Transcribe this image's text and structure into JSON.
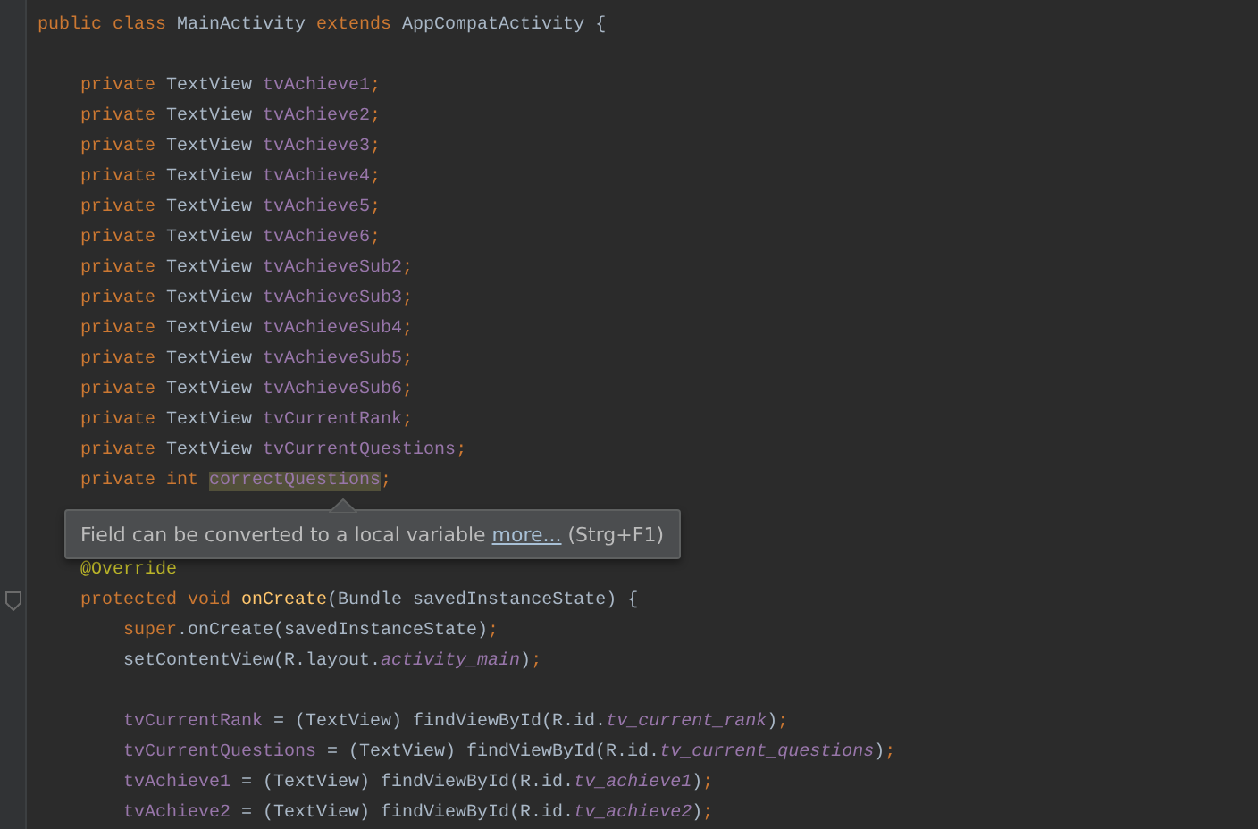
{
  "editor": {
    "lines": [
      {
        "kind": "code",
        "tokens": [
          {
            "text": "public class ",
            "kind": "keyword"
          },
          {
            "text": "MainActivity ",
            "kind": "plain"
          },
          {
            "text": "extends ",
            "kind": "keyword"
          },
          {
            "text": "AppCompatActivity {",
            "kind": "plain"
          }
        ]
      },
      {
        "kind": "blank"
      },
      {
        "kind": "code",
        "tokens": [
          {
            "text": "    private ",
            "kind": "keyword"
          },
          {
            "text": "TextView ",
            "kind": "plain"
          },
          {
            "text": "tvAchieve1",
            "kind": "field"
          },
          {
            "text": ";",
            "kind": "keyword"
          }
        ]
      },
      {
        "kind": "code",
        "tokens": [
          {
            "text": "    private ",
            "kind": "keyword"
          },
          {
            "text": "TextView ",
            "kind": "plain"
          },
          {
            "text": "tvAchieve2",
            "kind": "field"
          },
          {
            "text": ";",
            "kind": "keyword"
          }
        ]
      },
      {
        "kind": "code",
        "tokens": [
          {
            "text": "    private ",
            "kind": "keyword"
          },
          {
            "text": "TextView ",
            "kind": "plain"
          },
          {
            "text": "tvAchieve3",
            "kind": "field"
          },
          {
            "text": ";",
            "kind": "keyword"
          }
        ]
      },
      {
        "kind": "code",
        "tokens": [
          {
            "text": "    private ",
            "kind": "keyword"
          },
          {
            "text": "TextView ",
            "kind": "plain"
          },
          {
            "text": "tvAchieve4",
            "kind": "field"
          },
          {
            "text": ";",
            "kind": "keyword"
          }
        ]
      },
      {
        "kind": "code",
        "tokens": [
          {
            "text": "    private ",
            "kind": "keyword"
          },
          {
            "text": "TextView ",
            "kind": "plain"
          },
          {
            "text": "tvAchieve5",
            "kind": "field"
          },
          {
            "text": ";",
            "kind": "keyword"
          }
        ]
      },
      {
        "kind": "code",
        "tokens": [
          {
            "text": "    private ",
            "kind": "keyword"
          },
          {
            "text": "TextView ",
            "kind": "plain"
          },
          {
            "text": "tvAchieve6",
            "kind": "field"
          },
          {
            "text": ";",
            "kind": "keyword"
          }
        ]
      },
      {
        "kind": "code",
        "tokens": [
          {
            "text": "    private ",
            "kind": "keyword"
          },
          {
            "text": "TextView ",
            "kind": "plain"
          },
          {
            "text": "tvAchieveSub2",
            "kind": "field"
          },
          {
            "text": ";",
            "kind": "keyword"
          }
        ]
      },
      {
        "kind": "code",
        "tokens": [
          {
            "text": "    private ",
            "kind": "keyword"
          },
          {
            "text": "TextView ",
            "kind": "plain"
          },
          {
            "text": "tvAchieveSub3",
            "kind": "field"
          },
          {
            "text": ";",
            "kind": "keyword"
          }
        ]
      },
      {
        "kind": "code",
        "tokens": [
          {
            "text": "    private ",
            "kind": "keyword"
          },
          {
            "text": "TextView ",
            "kind": "plain"
          },
          {
            "text": "tvAchieveSub4",
            "kind": "field"
          },
          {
            "text": ";",
            "kind": "keyword"
          }
        ]
      },
      {
        "kind": "code",
        "tokens": [
          {
            "text": "    private ",
            "kind": "keyword"
          },
          {
            "text": "TextView ",
            "kind": "plain"
          },
          {
            "text": "tvAchieveSub5",
            "kind": "field"
          },
          {
            "text": ";",
            "kind": "keyword"
          }
        ]
      },
      {
        "kind": "code",
        "tokens": [
          {
            "text": "    private ",
            "kind": "keyword"
          },
          {
            "text": "TextView ",
            "kind": "plain"
          },
          {
            "text": "tvAchieveSub6",
            "kind": "field"
          },
          {
            "text": ";",
            "kind": "keyword"
          }
        ]
      },
      {
        "kind": "code",
        "tokens": [
          {
            "text": "    private ",
            "kind": "keyword"
          },
          {
            "text": "TextView ",
            "kind": "plain"
          },
          {
            "text": "tvCurrentRank",
            "kind": "field"
          },
          {
            "text": ";",
            "kind": "keyword"
          }
        ]
      },
      {
        "kind": "code",
        "tokens": [
          {
            "text": "    private ",
            "kind": "keyword"
          },
          {
            "text": "TextView ",
            "kind": "plain"
          },
          {
            "text": "tvCurrentQuestions",
            "kind": "field"
          },
          {
            "text": ";",
            "kind": "keyword"
          }
        ]
      },
      {
        "kind": "code",
        "tokens": [
          {
            "text": "    private int ",
            "kind": "keyword"
          },
          {
            "text": "correctQuestions",
            "kind": "highlighted"
          },
          {
            "text": ";",
            "kind": "keyword"
          }
        ]
      },
      {
        "kind": "blank"
      },
      {
        "kind": "blank"
      },
      {
        "kind": "code",
        "tokens": [
          {
            "text": "    @Override",
            "kind": "annotation"
          }
        ]
      },
      {
        "kind": "code",
        "tokens": [
          {
            "text": "    protected void ",
            "kind": "keyword"
          },
          {
            "text": "onCreate",
            "kind": "method"
          },
          {
            "text": "(Bundle savedInstanceState) {",
            "kind": "plain"
          }
        ],
        "foldable": true
      },
      {
        "kind": "code",
        "tokens": [
          {
            "text": "        super",
            "kind": "keyword"
          },
          {
            "text": ".onCreate(savedInstanceState)",
            "kind": "plain"
          },
          {
            "text": ";",
            "kind": "keyword"
          }
        ]
      },
      {
        "kind": "code",
        "tokens": [
          {
            "text": "        setContentView(R.layout.",
            "kind": "plain"
          },
          {
            "text": "activity_main",
            "kind": "constant"
          },
          {
            "text": ")",
            "kind": "plain"
          },
          {
            "text": ";",
            "kind": "keyword"
          }
        ]
      },
      {
        "kind": "blank"
      },
      {
        "kind": "code",
        "tokens": [
          {
            "text": "        tvCurrentRank",
            "kind": "field"
          },
          {
            "text": " = (TextView) findViewById(R.id.",
            "kind": "plain"
          },
          {
            "text": "tv_current_rank",
            "kind": "constant"
          },
          {
            "text": ")",
            "kind": "plain"
          },
          {
            "text": ";",
            "kind": "keyword"
          }
        ]
      },
      {
        "kind": "code",
        "tokens": [
          {
            "text": "        tvCurrentQuestions",
            "kind": "field"
          },
          {
            "text": " = (TextView) findViewById(R.id.",
            "kind": "plain"
          },
          {
            "text": "tv_current_questions",
            "kind": "constant"
          },
          {
            "text": ")",
            "kind": "plain"
          },
          {
            "text": ";",
            "kind": "keyword"
          }
        ]
      },
      {
        "kind": "code",
        "tokens": [
          {
            "text": "        tvAchieve1",
            "kind": "field"
          },
          {
            "text": " = (TextView) findViewById(R.id.",
            "kind": "plain"
          },
          {
            "text": "tv_achieve1",
            "kind": "constant"
          },
          {
            "text": ")",
            "kind": "plain"
          },
          {
            "text": ";",
            "kind": "keyword"
          }
        ]
      },
      {
        "kind": "code",
        "tokens": [
          {
            "text": "        tvAchieve2",
            "kind": "field"
          },
          {
            "text": " = (TextView) findViewById(R.id.",
            "kind": "plain"
          },
          {
            "text": "tv_achieve2",
            "kind": "constant"
          },
          {
            "text": ")",
            "kind": "plain"
          },
          {
            "text": ";",
            "kind": "keyword"
          }
        ]
      }
    ]
  },
  "tooltip": {
    "text": "Field can be converted to a local variable",
    "link": "more...",
    "shortcut": "(Strg+F1)"
  }
}
